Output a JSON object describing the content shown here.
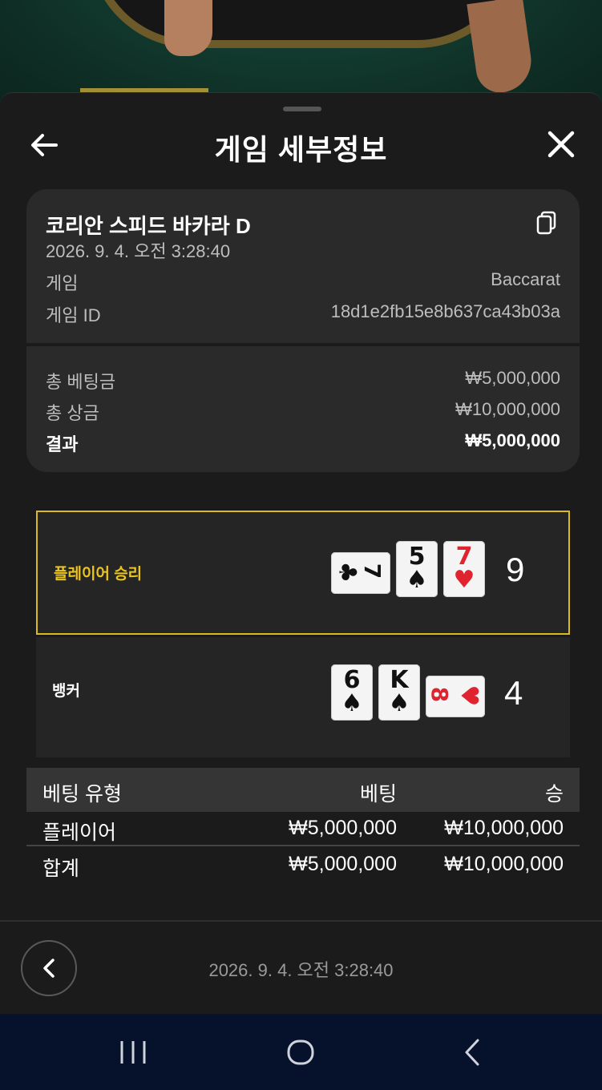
{
  "sheet": {
    "title": "게임 세부정보"
  },
  "info": {
    "game_name": "코리안 스피드 바카라 D",
    "datetime": "2026. 9. 4. 오전 3:28:40",
    "game_label": "게임",
    "game_value": "Baccarat",
    "game_id_label": "게임 ID",
    "game_id_value": "18d1e2fb15e8b637ca43b03a",
    "total_bet_label": "총 베팅금",
    "total_bet_value": "₩5,000,000",
    "total_prize_label": "총 상금",
    "total_prize_value": "₩10,000,000",
    "result_label": "결과",
    "result_value": "₩5,000,000"
  },
  "outcome": {
    "player": {
      "label": "플레이어 승리",
      "score": "9",
      "cards": [
        {
          "rank": "7",
          "suit": "♣",
          "color": "black",
          "orientation": "sideways"
        },
        {
          "rank": "5",
          "suit": "♠",
          "color": "black",
          "orientation": "upright"
        },
        {
          "rank": "7",
          "suit": "♥",
          "color": "red",
          "orientation": "upright"
        }
      ]
    },
    "banker": {
      "label": "뱅커",
      "score": "4",
      "cards": [
        {
          "rank": "6",
          "suit": "♠",
          "color": "black",
          "orientation": "upright"
        },
        {
          "rank": "K",
          "suit": "♠",
          "color": "black",
          "orientation": "upright"
        },
        {
          "rank": "8",
          "suit": "♥",
          "color": "red",
          "orientation": "sideways"
        }
      ]
    },
    "accent_color": "#d9bb1c"
  },
  "bets": {
    "headers": {
      "type": "베팅 유형",
      "bet": "베팅",
      "win": "승"
    },
    "rows": [
      {
        "type": "플레이어",
        "bet": "₩5,000,000",
        "win": "₩10,000,000"
      }
    ],
    "total": {
      "type": "합계",
      "bet": "₩5,000,000",
      "win": "₩10,000,000"
    }
  },
  "footer": {
    "datetime": "2026. 9. 4. 오전 3:28:40"
  },
  "icons": {
    "back": "arrow-left-icon",
    "close": "close-icon",
    "copy": "copy-icon",
    "footer_back": "chevron-left-icon",
    "nav_recents": "recents-icon",
    "nav_home": "home-icon",
    "nav_back": "nav-back-icon"
  }
}
